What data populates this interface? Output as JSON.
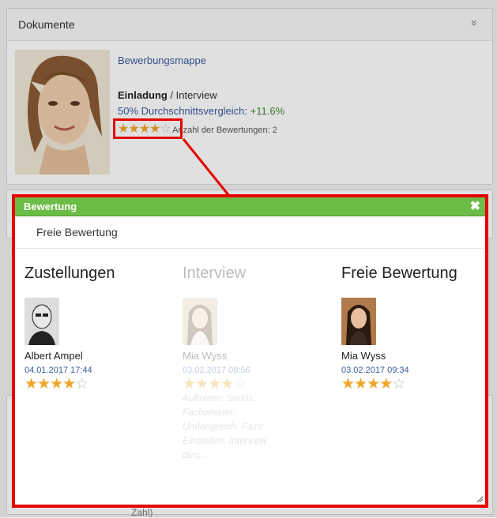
{
  "panel": {
    "title": "Dokumente",
    "collapse_icon": "»",
    "link_mappe": "Bewerbungsmappe",
    "status_bold": "Einladung",
    "status_rest": " / Interview",
    "comparison_label": "50% Durchschnittsvergleich:",
    "comparison_value": "+11.6%",
    "rating_count_label": "Anzahl der Bewertungen: 2",
    "rating_value": 4,
    "rating_max": 5
  },
  "bottom_text": "Zahl)",
  "dialog": {
    "title": "Bewertung",
    "close_icon": "✖",
    "tab_label": "Freie Bewertung",
    "columns": [
      {
        "heading": "Zustellungen",
        "name": "Albert Ampel",
        "date": "04.01.2017 17:44",
        "rating": 4,
        "faded": false
      },
      {
        "heading": "Interview",
        "name": "Mia Wyss",
        "date": "03.02.2017 08:56",
        "rating": 4,
        "faded": true,
        "comment": "Auftreten: Seriös. Fachwissen: Umfangreich. Fazit: Einstellen. Interview durc..."
      },
      {
        "heading": "Freie Bewertung",
        "name": "Mia Wyss",
        "date": "03.02.2017 09:34",
        "rating": 4,
        "faded": false
      }
    ]
  },
  "colors": {
    "accent_green": "#6bbd45",
    "highlight_red": "#e60000",
    "link_blue": "#3a5b9f",
    "star_gold": "#f0a52b"
  }
}
